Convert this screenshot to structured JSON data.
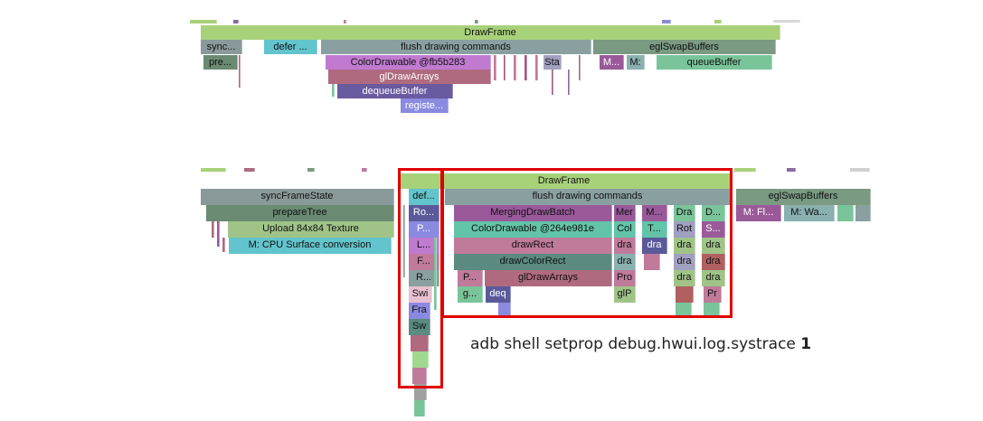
{
  "caption": {
    "text": "adb shell setprop debug.hwui.log.systrace ",
    "value": "1"
  },
  "colors": {
    "drawframe": "#a8d27a",
    "flush": "#8aa0a0",
    "egl": "#7a9a82",
    "highlight": "#e00000"
  },
  "top_trace": {
    "drawframe": "DrawFrame",
    "sync": "sync...",
    "defer": "defer ...",
    "flush": "flush drawing commands",
    "egl": "eglSwapBuffers",
    "pre": "pre...",
    "colordrawable": "ColorDrawable @fb5b283",
    "sta": "Sta",
    "m1": "M...",
    "m2": "M:",
    "queue": "queueBuffer",
    "gldraw": "glDrawArrays",
    "dequeue": "dequeueBuffer",
    "register": "registe..."
  },
  "bottom_trace": {
    "drawframe": "DrawFrame",
    "sync": "syncFrameState",
    "def": "def...",
    "flush": "flush drawing commands",
    "egl": "eglSwapBuffers",
    "prepare": "prepareTree",
    "ro": "Ro...",
    "merging": "MergingDrawBatch",
    "mer": "Mer",
    "m": "M...",
    "dra1": "Dra",
    "d": "D...",
    "mfl": "M: Fl...",
    "mwa": "M: Wa...",
    "upload": "Upload 84x84 Texture",
    "p1": "P...",
    "colordrawable": "ColorDrawable @264e981e",
    "col": "Col",
    "t": "T...",
    "rot": "Rot",
    "s": "S...",
    "cpu": "M: CPU Surface conversion",
    "l": "L...",
    "drawrect": "drawRect",
    "dra": "dra",
    "f": "F...",
    "drawcolorrect": "drawColorRect",
    "r": "R...",
    "p2": "P...",
    "gldraw": "glDrawArrays",
    "pro": "Pro",
    "swi": "Swi",
    "g": "g...",
    "deq": "deq",
    "glp": "glP",
    "pr": "Pr",
    "fra": "Fra",
    "sw": "Sw"
  }
}
